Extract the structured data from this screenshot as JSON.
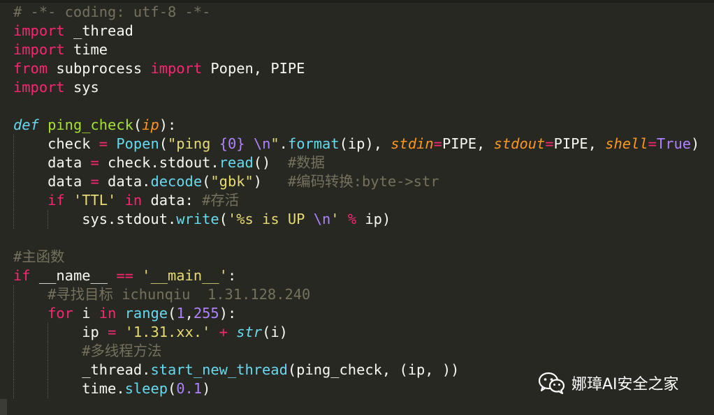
{
  "editor": {
    "theme_colors": {
      "background": "#272822",
      "keyword": "#f92672",
      "function": "#a6e22e",
      "string": "#e6db74",
      "number": "#ae81ff",
      "comment": "#75715e",
      "parameter": "#fd971f",
      "builtin": "#66d9ef",
      "text": "#f8f8f2"
    },
    "lines": [
      {
        "indent": 0,
        "guides": 0,
        "tokens": [
          {
            "t": "# -*- coding: utf-8 -*-",
            "c": "cmt"
          }
        ]
      },
      {
        "indent": 0,
        "guides": 0,
        "tokens": [
          {
            "t": "import",
            "c": "kw"
          },
          {
            "t": " _thread",
            "c": ""
          }
        ]
      },
      {
        "indent": 0,
        "guides": 0,
        "tokens": [
          {
            "t": "import",
            "c": "kw"
          },
          {
            "t": " time",
            "c": ""
          }
        ]
      },
      {
        "indent": 0,
        "guides": 0,
        "tokens": [
          {
            "t": "from",
            "c": "kw"
          },
          {
            "t": " subprocess ",
            "c": ""
          },
          {
            "t": "import",
            "c": "kw"
          },
          {
            "t": " Popen, PIPE",
            "c": ""
          }
        ]
      },
      {
        "indent": 0,
        "guides": 0,
        "tokens": [
          {
            "t": "import",
            "c": "kw"
          },
          {
            "t": " sys",
            "c": ""
          }
        ]
      },
      {
        "indent": 0,
        "guides": 0,
        "tokens": []
      },
      {
        "indent": 0,
        "guides": 0,
        "tokens": [
          {
            "t": "def",
            "c": "def"
          },
          {
            "t": " ",
            "c": ""
          },
          {
            "t": "ping_check",
            "c": "fn"
          },
          {
            "t": "(",
            "c": ""
          },
          {
            "t": "ip",
            "c": "it"
          },
          {
            "t": "):",
            "c": ""
          }
        ]
      },
      {
        "indent": 4,
        "guides": 1,
        "tokens": [
          {
            "t": "check ",
            "c": ""
          },
          {
            "t": "=",
            "c": "kw"
          },
          {
            "t": " ",
            "c": ""
          },
          {
            "t": "Popen",
            "c": "bi"
          },
          {
            "t": "(",
            "c": ""
          },
          {
            "t": "\"ping ",
            "c": "str"
          },
          {
            "t": "{0}",
            "c": "num"
          },
          {
            "t": " ",
            "c": "str"
          },
          {
            "t": "\\n",
            "c": "num"
          },
          {
            "t": "\"",
            "c": "str"
          },
          {
            "t": ".",
            "c": ""
          },
          {
            "t": "format",
            "c": "bi"
          },
          {
            "t": "(ip), ",
            "c": ""
          },
          {
            "t": "stdin",
            "c": "it"
          },
          {
            "t": "=",
            "c": "kw"
          },
          {
            "t": "PIPE, ",
            "c": ""
          },
          {
            "t": "stdout",
            "c": "it"
          },
          {
            "t": "=",
            "c": "kw"
          },
          {
            "t": "PIPE, ",
            "c": ""
          },
          {
            "t": "shell",
            "c": "it"
          },
          {
            "t": "=",
            "c": "kw"
          },
          {
            "t": "True",
            "c": "num"
          },
          {
            "t": ")",
            "c": ""
          }
        ]
      },
      {
        "indent": 4,
        "guides": 1,
        "tokens": [
          {
            "t": "data ",
            "c": ""
          },
          {
            "t": "=",
            "c": "kw"
          },
          {
            "t": " check.stdout.",
            "c": ""
          },
          {
            "t": "read",
            "c": "bi"
          },
          {
            "t": "()  ",
            "c": ""
          },
          {
            "t": "#数据",
            "c": "cmt"
          }
        ]
      },
      {
        "indent": 4,
        "guides": 1,
        "tokens": [
          {
            "t": "data ",
            "c": ""
          },
          {
            "t": "=",
            "c": "kw"
          },
          {
            "t": " data.",
            "c": ""
          },
          {
            "t": "decode",
            "c": "bi"
          },
          {
            "t": "(",
            "c": ""
          },
          {
            "t": "\"gbk\"",
            "c": "str"
          },
          {
            "t": ")   ",
            "c": ""
          },
          {
            "t": "#编码转换:byte->str",
            "c": "cmt"
          }
        ]
      },
      {
        "indent": 4,
        "guides": 1,
        "tokens": [
          {
            "t": "if",
            "c": "kw"
          },
          {
            "t": " ",
            "c": ""
          },
          {
            "t": "'TTL'",
            "c": "str"
          },
          {
            "t": " ",
            "c": ""
          },
          {
            "t": "in",
            "c": "kw"
          },
          {
            "t": " data: ",
            "c": ""
          },
          {
            "t": "#存活",
            "c": "cmt"
          }
        ]
      },
      {
        "indent": 8,
        "guides": 2,
        "tokens": [
          {
            "t": "sys.stdout.",
            "c": ""
          },
          {
            "t": "write",
            "c": "bi"
          },
          {
            "t": "(",
            "c": ""
          },
          {
            "t": "'%s is UP ",
            "c": "str"
          },
          {
            "t": "\\n",
            "c": "num"
          },
          {
            "t": "'",
            "c": "str"
          },
          {
            "t": " ",
            "c": ""
          },
          {
            "t": "%",
            "c": "kw"
          },
          {
            "t": " ip)",
            "c": ""
          }
        ]
      },
      {
        "indent": 0,
        "guides": 0,
        "tokens": []
      },
      {
        "indent": 0,
        "guides": 0,
        "tokens": [
          {
            "t": "#主函数",
            "c": "cmt"
          }
        ]
      },
      {
        "indent": 0,
        "guides": 0,
        "tokens": [
          {
            "t": "if",
            "c": "kw"
          },
          {
            "t": " __name__ ",
            "c": ""
          },
          {
            "t": "==",
            "c": "kw"
          },
          {
            "t": " ",
            "c": ""
          },
          {
            "t": "'__main__'",
            "c": "str"
          },
          {
            "t": ":",
            "c": ""
          }
        ]
      },
      {
        "indent": 4,
        "guides": 1,
        "tokens": [
          {
            "t": "#寻找目标 ichunqiu  1.31.128.240",
            "c": "cmt"
          }
        ]
      },
      {
        "indent": 4,
        "guides": 1,
        "tokens": [
          {
            "t": "for",
            "c": "kw"
          },
          {
            "t": " i ",
            "c": ""
          },
          {
            "t": "in",
            "c": "kw"
          },
          {
            "t": " ",
            "c": ""
          },
          {
            "t": "range",
            "c": "bi"
          },
          {
            "t": "(",
            "c": ""
          },
          {
            "t": "1",
            "c": "num"
          },
          {
            "t": ",",
            "c": ""
          },
          {
            "t": "255",
            "c": "num"
          },
          {
            "t": "):",
            "c": ""
          }
        ]
      },
      {
        "indent": 8,
        "guides": 2,
        "tokens": [
          {
            "t": "ip ",
            "c": ""
          },
          {
            "t": "=",
            "c": "kw"
          },
          {
            "t": " ",
            "c": ""
          },
          {
            "t": "'1.31.xx.'",
            "c": "str"
          },
          {
            "t": " ",
            "c": ""
          },
          {
            "t": "+",
            "c": "kw"
          },
          {
            "t": " ",
            "c": ""
          },
          {
            "t": "str",
            "c": "bii"
          },
          {
            "t": "(i)",
            "c": ""
          }
        ]
      },
      {
        "indent": 8,
        "guides": 2,
        "tokens": [
          {
            "t": "#多线程方法",
            "c": "cmt"
          }
        ]
      },
      {
        "indent": 8,
        "guides": 2,
        "tokens": [
          {
            "t": "_thread.",
            "c": ""
          },
          {
            "t": "start_new_thread",
            "c": "bi"
          },
          {
            "t": "(ping_check, (ip, ))",
            "c": ""
          }
        ]
      },
      {
        "indent": 8,
        "guides": 2,
        "tokens": [
          {
            "t": "time.",
            "c": ""
          },
          {
            "t": "sleep",
            "c": "bi"
          },
          {
            "t": "(",
            "c": ""
          },
          {
            "t": "0.1",
            "c": "num"
          },
          {
            "t": ")",
            "c": ""
          }
        ]
      }
    ]
  },
  "watermark": {
    "icon": "wechat-icon",
    "text": "娜璋AI安全之家"
  }
}
